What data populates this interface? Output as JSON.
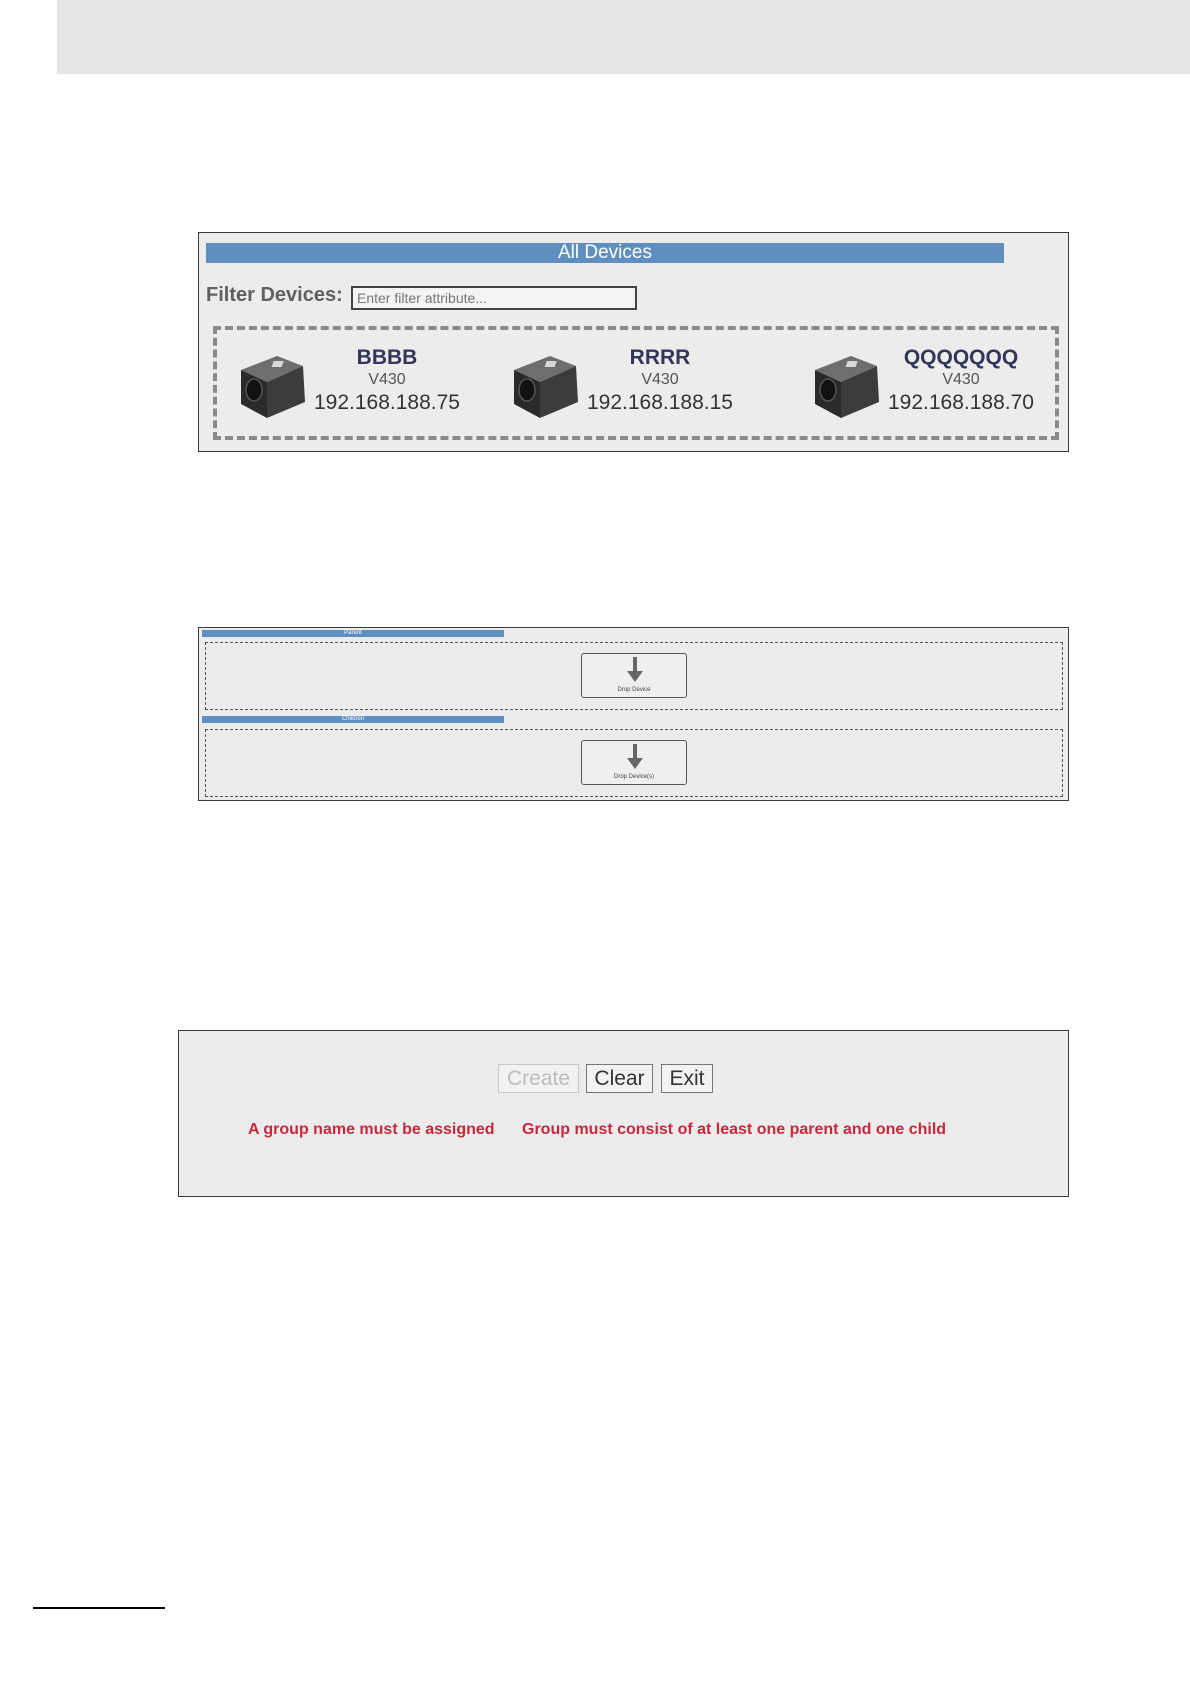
{
  "all_devices": {
    "title": "All Devices",
    "filter_label": "Filter Devices:",
    "filter_placeholder": "Enter filter attribute...",
    "devices": [
      {
        "name": "BBBB",
        "model": "V430",
        "ip": "192.168.188.75"
      },
      {
        "name": "RRRR",
        "model": "V430",
        "ip": "192.168.188.15"
      },
      {
        "name": "QQQQQQQ",
        "model": "V430",
        "ip": "192.168.188.70"
      }
    ]
  },
  "group": {
    "parent_label": "Parent",
    "parent_drop_label": "Drop Device",
    "children_label": "Children",
    "children_drop_label": "Drop Device(s)"
  },
  "actions": {
    "create_label": "Create",
    "clear_label": "Clear",
    "exit_label": "Exit",
    "errors": [
      "A group name must be assigned",
      "Group must consist of at least one parent and one child"
    ]
  },
  "icons": {
    "device": "camera-device-icon",
    "drop": "down-arrow-icon"
  },
  "colors": {
    "title_bar": "#5f8fbf",
    "error": "#c8283c",
    "device_name": "#35355a"
  }
}
